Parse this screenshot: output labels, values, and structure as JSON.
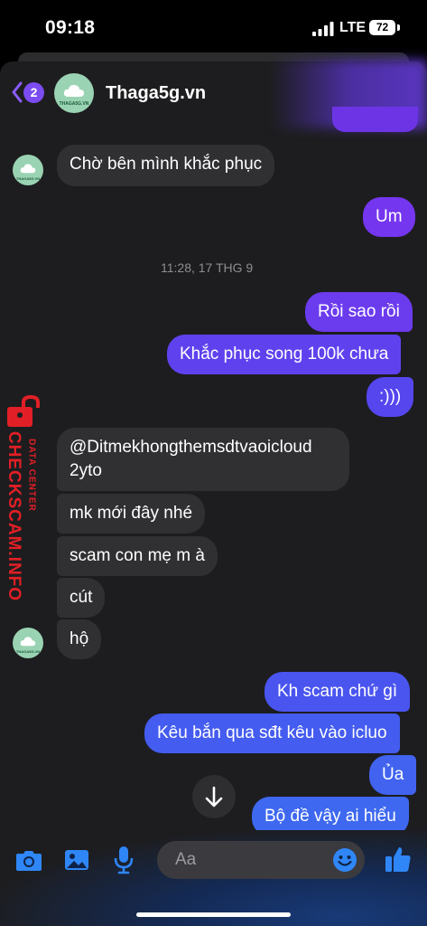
{
  "status_bar": {
    "time": "09:18",
    "network": "LTE",
    "battery": "72"
  },
  "header": {
    "back_badge": "2",
    "contact_name": "Thaga5g.vn",
    "avatar_text": "THAGA5G.VN"
  },
  "messages": [
    {
      "id": "m1",
      "dir": "in",
      "text": "Chờ bên mình khắc phục"
    },
    {
      "id": "m2",
      "dir": "out",
      "text": "Um"
    },
    {
      "id": "m3",
      "dir": "out",
      "text": "Rồi sao rồi"
    },
    {
      "id": "m4",
      "dir": "out",
      "text": "Khắc phục song 100k chưa"
    },
    {
      "id": "m5",
      "dir": "out",
      "text": ":)))"
    },
    {
      "id": "m6",
      "dir": "in",
      "text": "@Ditmekhongthemsdtvaoicloud",
      "text2": "2yto"
    },
    {
      "id": "m7",
      "dir": "in",
      "text": "mk mới đây nhé"
    },
    {
      "id": "m8",
      "dir": "in",
      "text": "scam con mẹ m à"
    },
    {
      "id": "m9",
      "dir": "in",
      "text": "cút"
    },
    {
      "id": "m10",
      "dir": "in",
      "text": "hộ"
    },
    {
      "id": "m11",
      "dir": "out",
      "text": "Kh scam chứ gì"
    },
    {
      "id": "m12",
      "dir": "out",
      "text": "Kêu bắn qua sđt kêu vào icluo"
    },
    {
      "id": "m13",
      "dir": "out",
      "text": "Ủa"
    },
    {
      "id": "m14",
      "dir": "out",
      "text": "Bộ đề vậy ai hiểu"
    }
  ],
  "timestamp": "11:28, 17 THG 9",
  "watermark": {
    "brand": "CHECKSCAM.INFO",
    "sub": "DATA CENTER"
  },
  "composer": {
    "placeholder": "Aa"
  },
  "icons": [
    "back-chevron-icon",
    "camera-icon",
    "image-icon",
    "microphone-icon",
    "emoji-icon",
    "thumbs-up-icon",
    "arrow-down-icon"
  ],
  "colors": {
    "outgoing_top": "#7a3ef0",
    "outgoing_bottom": "#3f6af0",
    "incoming": "#303033",
    "watermark": "#e21f26"
  }
}
